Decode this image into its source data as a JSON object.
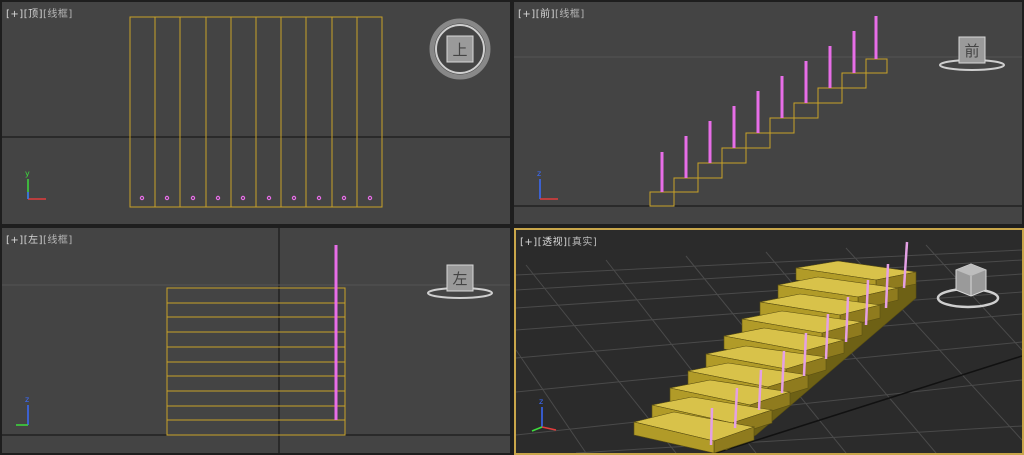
{
  "viewports": {
    "top": {
      "plus": "[+]",
      "view": "[顶]",
      "mode": "[线框]",
      "cube_label": "上"
    },
    "front": {
      "plus": "[+]",
      "view": "[前]",
      "mode": "[线框]",
      "cube_label": "前"
    },
    "left": {
      "plus": "[+]",
      "view": "[左]",
      "mode": "[线框]",
      "cube_label": "左"
    },
    "persp": {
      "plus": "[+]",
      "view": "[透视]",
      "mode": "[真实]",
      "cube_label": ""
    }
  },
  "axis_labels": {
    "x": "x",
    "y": "y",
    "z": "z"
  },
  "scene": {
    "step_count": 10,
    "colors": {
      "stair_wire": "#c9a227",
      "stair_solid_top": "#d8c24a",
      "stair_solid_front": "#b19b28",
      "stair_solid_side": "#8f7b1e",
      "railing": "#e86ee8",
      "grid": "#555555",
      "axis_line": "#111111",
      "active_border": "#c9a64a"
    }
  }
}
